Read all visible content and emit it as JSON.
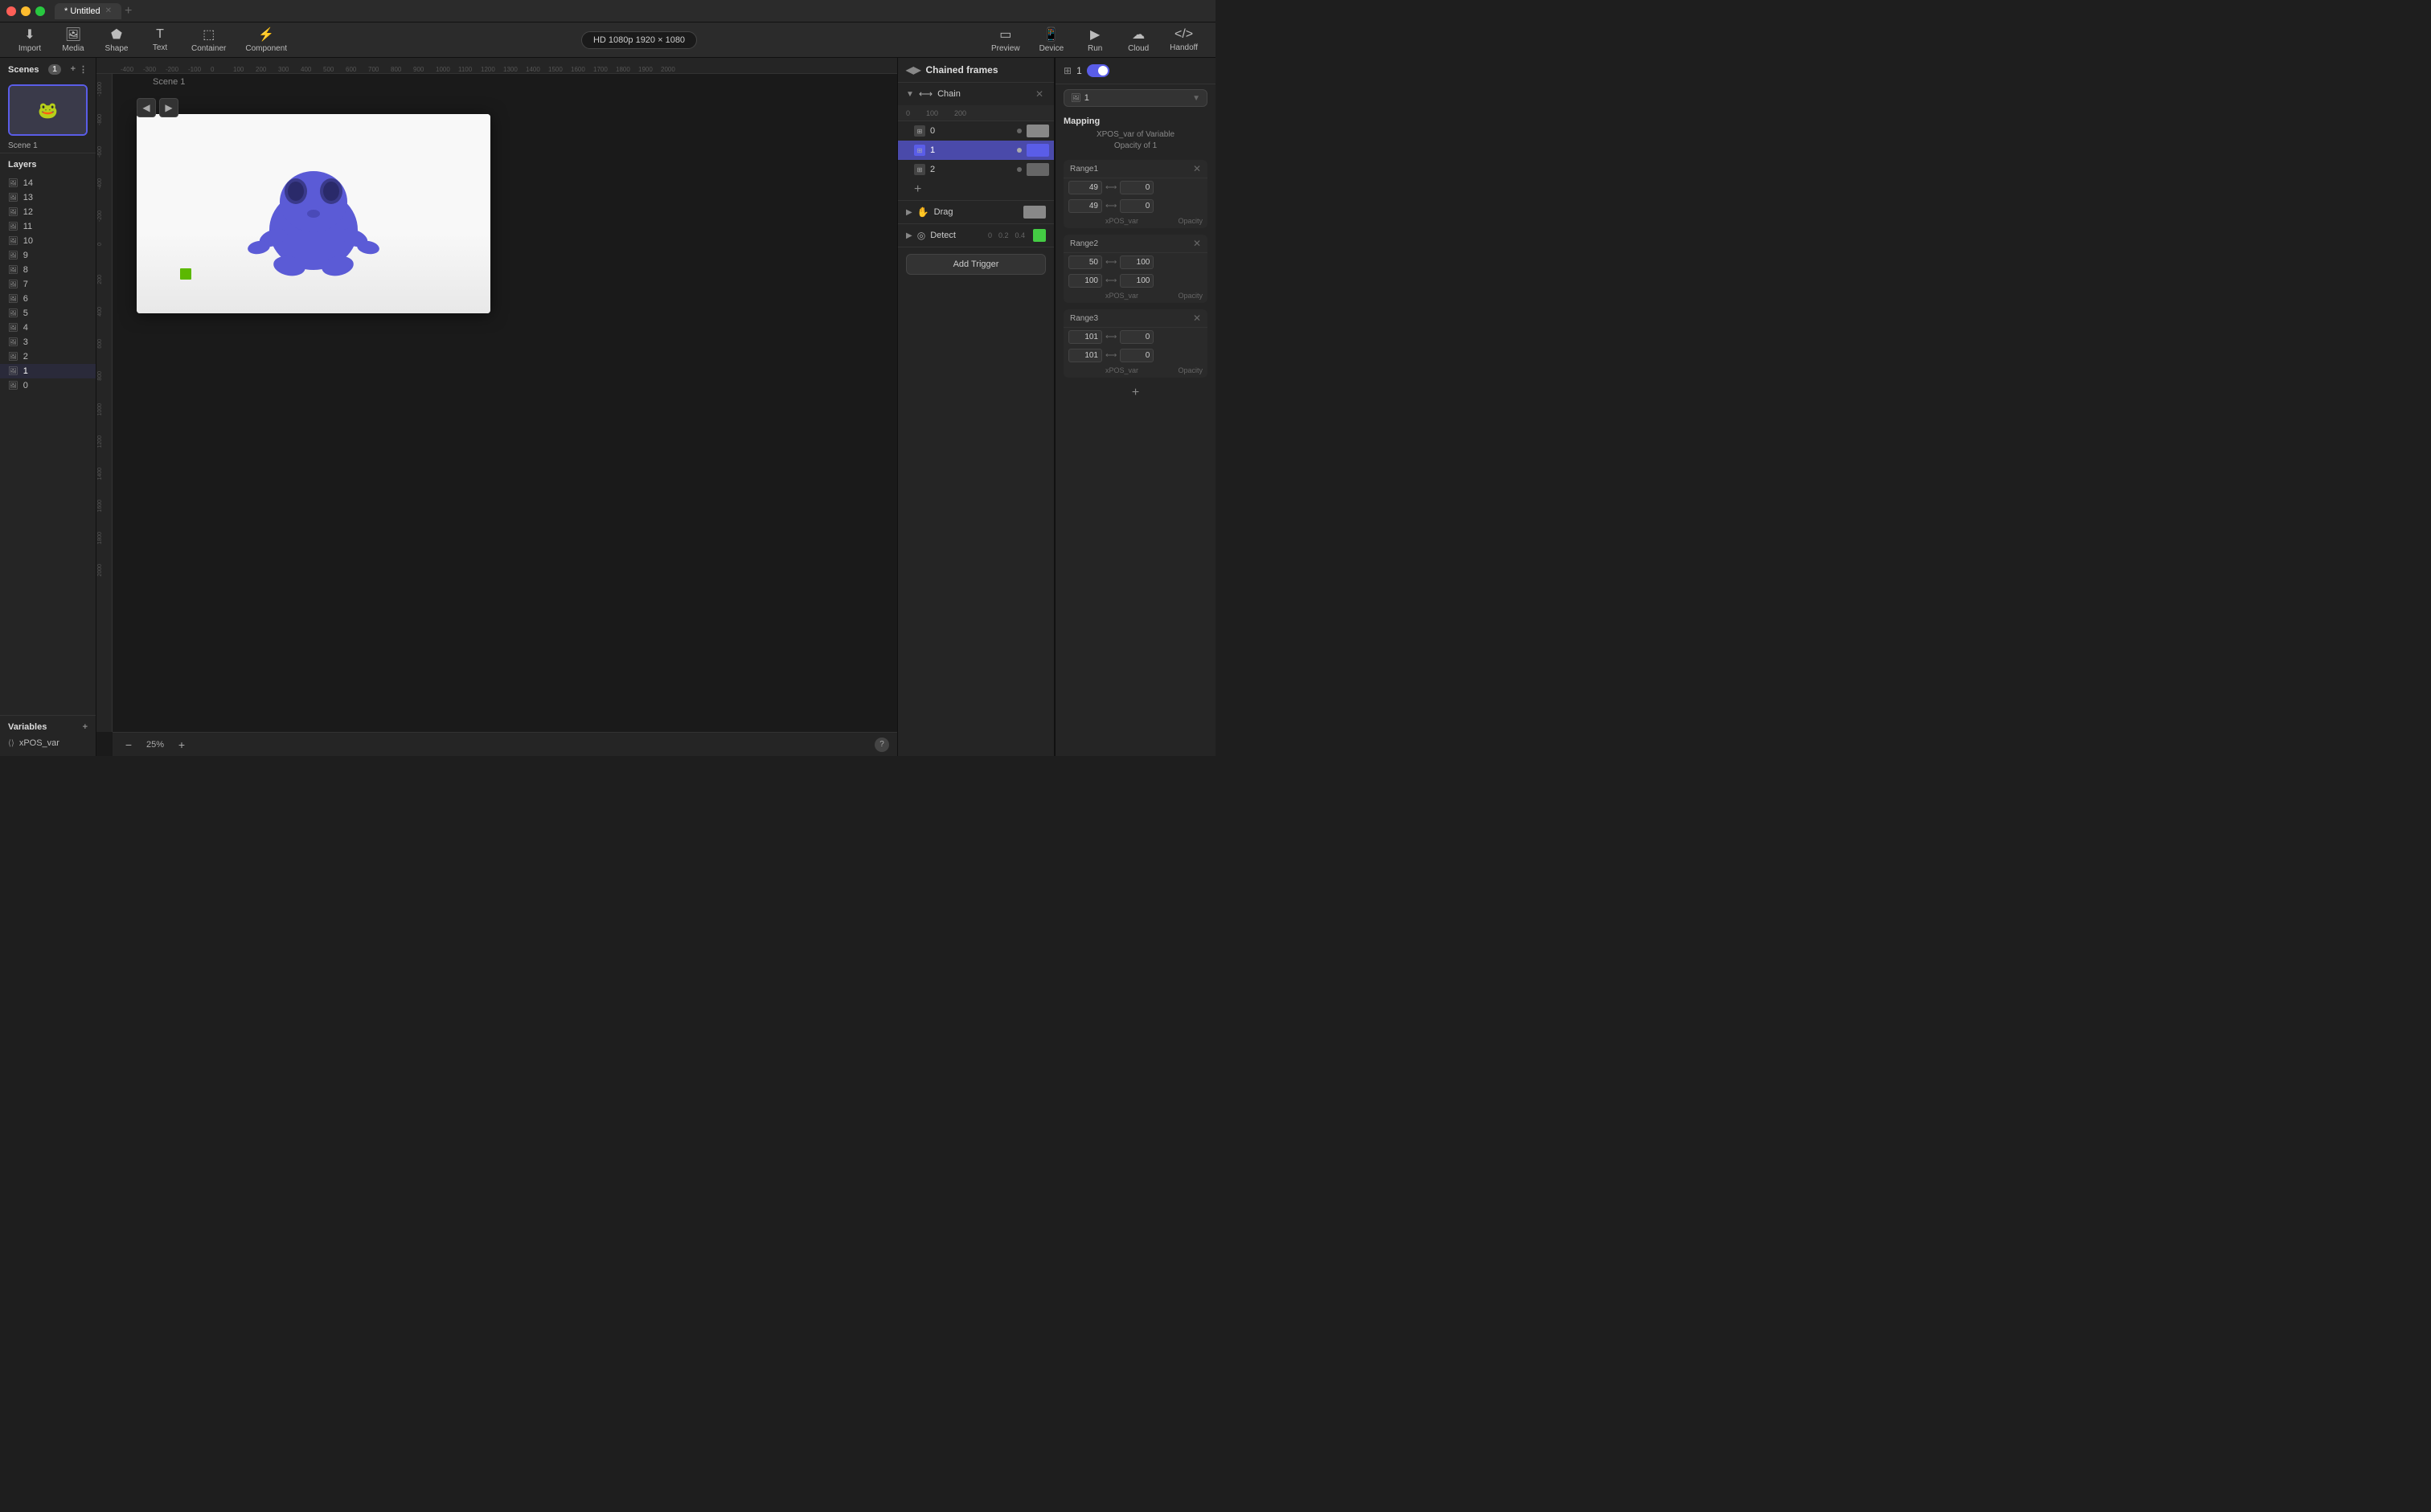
{
  "titlebar": {
    "tab_name": "* Untitled",
    "tab_close": "✕"
  },
  "toolbar": {
    "import_label": "Import",
    "media_label": "Media",
    "shape_label": "Shape",
    "text_label": "Text",
    "container_label": "Container",
    "component_label": "Component",
    "resolution": "HD 1080p  1920 × 1080",
    "preview_label": "Preview",
    "device_label": "Device",
    "run_label": "Run",
    "cloud_label": "Cloud",
    "handoff_label": "Handoff"
  },
  "scenes": {
    "title": "Scenes",
    "count": "1",
    "scene1_name": "Scene 1"
  },
  "layers": {
    "title": "Layers",
    "items": [
      {
        "id": "14",
        "name": "14"
      },
      {
        "id": "13",
        "name": "13"
      },
      {
        "id": "12",
        "name": "12"
      },
      {
        "id": "11",
        "name": "11"
      },
      {
        "id": "10",
        "name": "10"
      },
      {
        "id": "9",
        "name": "9"
      },
      {
        "id": "8",
        "name": "8"
      },
      {
        "id": "7",
        "name": "7"
      },
      {
        "id": "6",
        "name": "6"
      },
      {
        "id": "5",
        "name": "5"
      },
      {
        "id": "4",
        "name": "4"
      },
      {
        "id": "3",
        "name": "3"
      },
      {
        "id": "2",
        "name": "2"
      },
      {
        "id": "1",
        "name": "1"
      },
      {
        "id": "0",
        "name": "0"
      }
    ]
  },
  "variables": {
    "title": "Variables",
    "items": [
      {
        "name": "xPOS_var"
      }
    ]
  },
  "canvas": {
    "zoom": "25%",
    "scene_label": "Scene 1",
    "ruler_marks": [
      "-400",
      "-300",
      "-200",
      "-100",
      "0",
      "100",
      "200",
      "300",
      "400",
      "500",
      "600",
      "700",
      "800",
      "900",
      "1000",
      "1100",
      "1200",
      "1300",
      "1400",
      "1500",
      "1600",
      "1700",
      "1800",
      "1900",
      "2000"
    ],
    "ruler_left_marks": [
      "-1000",
      "-800",
      "-600",
      "-400",
      "-200",
      "0",
      "200",
      "400",
      "600",
      "800",
      "1000",
      "1200",
      "1400",
      "1600",
      "1800",
      "2000"
    ]
  },
  "chained_frames": {
    "title": "Chained frames",
    "chain_section": {
      "title": "Chain",
      "ruler_marks": [
        "0",
        "100",
        "200"
      ],
      "items": [
        {
          "id": "0",
          "selected": false,
          "color": "#888"
        },
        {
          "id": "1",
          "selected": true,
          "color": "#5a5de8"
        },
        {
          "id": "2",
          "selected": false,
          "color": "#666"
        }
      ],
      "add_label": "+"
    },
    "drag_section": {
      "title": "Drag",
      "color": "#888"
    },
    "detect_section": {
      "title": "Detect",
      "color": "#44cc44",
      "ruler_marks": [
        "0",
        "0.2",
        "0.4"
      ]
    },
    "add_trigger_label": "Add Trigger"
  },
  "mapping": {
    "header_num": "1",
    "layer_name": "1",
    "title": "Mapping",
    "desc_xpos": "XPOS_var of Variable",
    "desc_opacity": "Opacity of 1",
    "range1": {
      "label": "Range1",
      "row1_left": "49",
      "row1_right": "0",
      "row2_left": "49",
      "row2_right": "0",
      "label_left": "xPOS_var",
      "label_right": "Opacity"
    },
    "range2": {
      "label": "Range2",
      "row1_left": "50",
      "row1_right": "100",
      "row2_left": "100",
      "row2_right": "100",
      "label_left": "xPOS_var",
      "label_right": "Opacity"
    },
    "range3": {
      "label": "Range3",
      "row1_left": "101",
      "row1_right": "0",
      "row2_left": "101",
      "row2_right": "0",
      "label_left": "xPOS_var",
      "label_right": "Opacity"
    },
    "add_label": "+"
  }
}
